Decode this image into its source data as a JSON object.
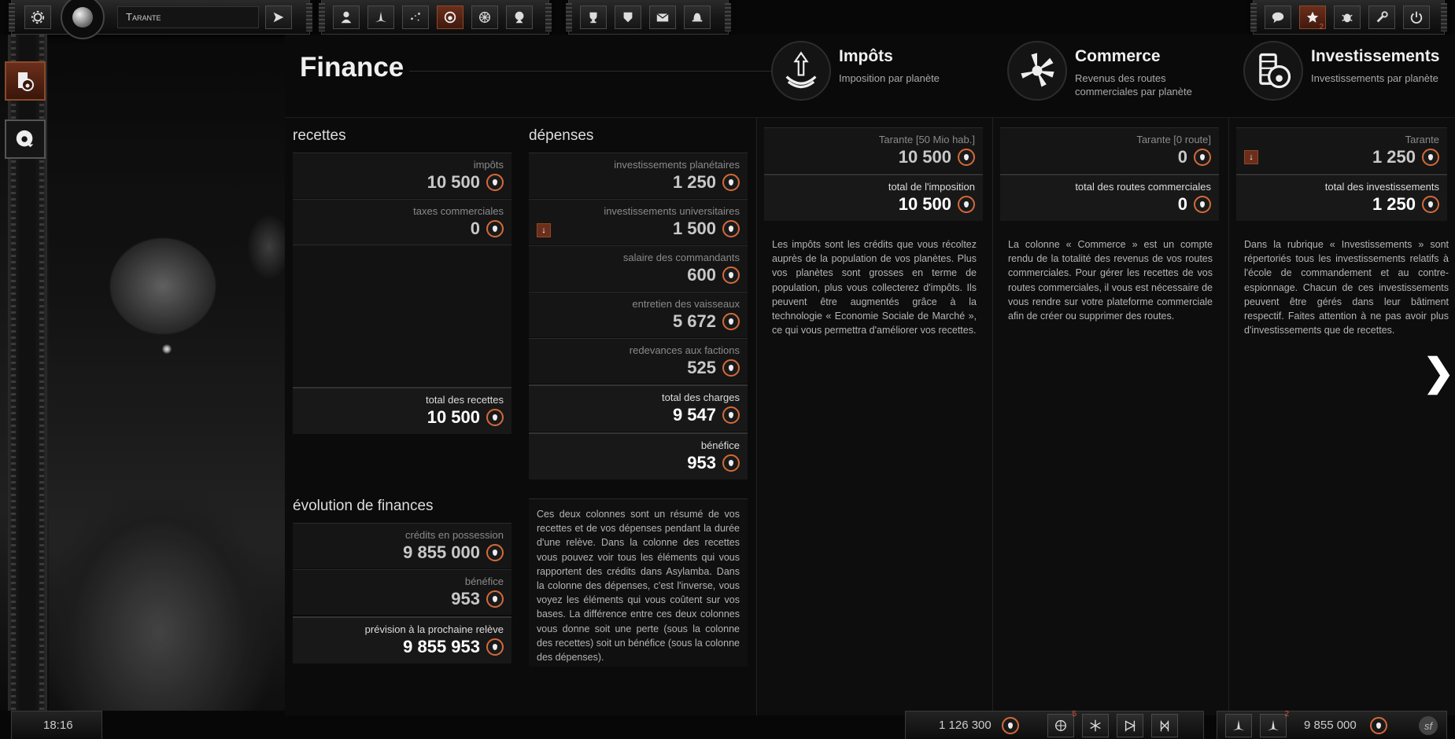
{
  "topbar": {
    "planet_name": "Tarante",
    "notif_badge": "2"
  },
  "page": {
    "title": "Finance"
  },
  "header_cols": [
    {
      "title": "Impôts",
      "subtitle": "Imposition par planète"
    },
    {
      "title": "Commerce",
      "subtitle": "Revenus des routes commerciales par planète"
    },
    {
      "title": "Investissements",
      "subtitle": "Investissements par planète"
    }
  ],
  "recettes": {
    "heading": "recettes",
    "items": [
      {
        "label": "impôts",
        "value": "10 500"
      },
      {
        "label": "taxes commerciales",
        "value": "0"
      }
    ],
    "total_label": "total des recettes",
    "total_value": "10 500"
  },
  "depenses": {
    "heading": "dépenses",
    "items": [
      {
        "label": "investissements planétaires",
        "value": "1 250"
      },
      {
        "label": "investissements universitaires",
        "value": "1 500"
      },
      {
        "label": "salaire des commandants",
        "value": "600"
      },
      {
        "label": "entretien des vaisseaux",
        "value": "5 672"
      },
      {
        "label": "redevances aux factions",
        "value": "525"
      }
    ],
    "total_label": "total des charges",
    "total_value": "9 547",
    "benefice_label": "bénéfice",
    "benefice_value": "953",
    "description": "Ces deux colonnes sont un résumé de vos recettes et de vos dépenses pendant la durée d'une relève. Dans la colonne des recettes vous pouvez voir tous les éléments qui vous rapportent des crédits dans Asylamba. Dans la colonne des dépenses, c'est l'inverse, vous voyez les éléments qui vous coûtent sur vos bases. La différence entre ces deux colonnes vous donne soit une perte (sous la colonne des recettes) soit un bénéfice (sous la colonne des dépenses)."
  },
  "evolution": {
    "heading": "évolution de finances",
    "credits_label": "crédits en possession",
    "credits_value": "9 855 000",
    "benefice_label": "bénéfice",
    "benefice_value": "953",
    "prevision_label": "prévision à la prochaine relève",
    "prevision_value": "9 855 953"
  },
  "impots": {
    "planet_label": "Tarante [50 Mio hab.]",
    "planet_value": "10 500",
    "total_label": "total de l'imposition",
    "total_value": "10 500",
    "description": "Les impôts sont les crédits que vous récoltez auprès de la population de vos planètes. Plus vos planètes sont grosses en terme de population, plus vous collecterez d'impôts. Ils peuvent être augmentés grâce à la technologie « Economie Sociale de Marché », ce qui vous permettra d'améliorer vos recettes."
  },
  "commerce": {
    "planet_label": "Tarante [0 route]",
    "planet_value": "0",
    "total_label": "total des routes commerciales",
    "total_value": "0",
    "description": "La colonne « Commerce » est un compte rendu de la totalité des revenus de vos routes commerciales. Pour gérer les recettes de vos routes commerciales, il vous est nécessaire de vous rendre sur votre plateforme commerciale afin de créer ou supprimer des routes."
  },
  "investissements": {
    "planet_label": "Tarante",
    "planet_value": "1 250",
    "total_label": "total des investissements",
    "total_value": "1 250",
    "description": "Dans la rubrique « Investissements » sont répertoriés tous les investissements relatifs à l'école de commandement et au contre-espionnage. Chacun de ces investissements peuvent être gérés dans leur bâtiment respectif. Faites attention à ne pas avoir plus d'investissements que de recettes."
  },
  "bottombar": {
    "time": "18:16",
    "resources": "1 126 300",
    "badge_a": "5",
    "badge_b": "2",
    "credits": "9 855 000"
  },
  "colors": {
    "accent": "#d46a3a",
    "active": "#6b2e1b"
  },
  "icons": [
    "gear-icon",
    "planet-icon",
    "send-icon",
    "user-icon",
    "fleet-icon",
    "map-icon",
    "finance-icon",
    "tech-icon",
    "spy-icon",
    "trophy-icon",
    "shield-icon",
    "mail-icon",
    "bell-icon",
    "chat-icon",
    "star-icon",
    "bug-icon",
    "wrench-icon",
    "power-icon"
  ]
}
